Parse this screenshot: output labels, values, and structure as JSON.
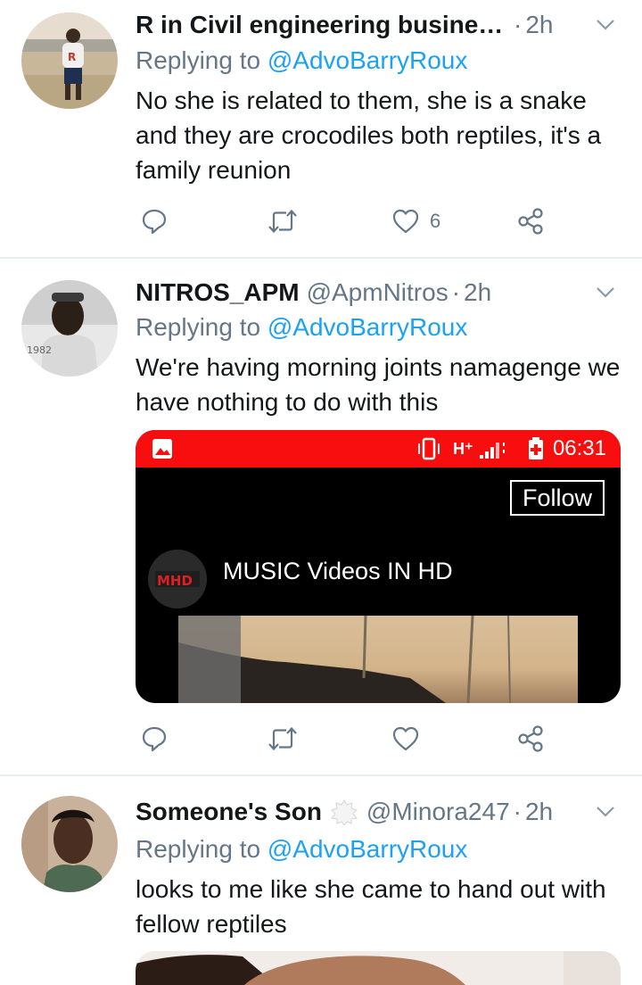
{
  "tweets": [
    {
      "name": "R in Civil engineering business ...",
      "handle": "",
      "time": "2h",
      "replying_label": "Replying to",
      "replying_to": "@AdvoBarryRoux",
      "text": "No she is related to them, she is a snake and they are crocodiles both reptiles, it's a family reunion",
      "likes": "6"
    },
    {
      "name": "NITROS_APM",
      "handle": "@ApmNitros",
      "time": "2h",
      "replying_label": "Replying to",
      "replying_to": "@AdvoBarryRoux",
      "text": "We're having morning joints namagenge we have nothing to do with this",
      "likes": "",
      "media": {
        "status_network": "H⁺",
        "status_time": "06:31",
        "follow_label": "Follow",
        "channel_name": "MUSIC Videos IN HD",
        "logo_text": "MHD"
      }
    },
    {
      "name": "Someone's Son",
      "handle": "@Minora247",
      "time": "2h",
      "replying_label": "Replying to",
      "replying_to": "@AdvoBarryRoux",
      "text": "looks to me like she came to hand out with fellow reptiles"
    }
  ],
  "avatar_texts": {
    "tweet1_shirt": "R",
    "tweet2_shirt": "1982"
  },
  "colors": {
    "accent": "#1da1f2",
    "secondary_text": "#657786",
    "divider": "#e6ecf0",
    "status_bar_red": "#f80e0e"
  },
  "icons": [
    "reply-icon",
    "retweet-icon",
    "like-icon",
    "share-icon",
    "chevron-down-icon",
    "gallery-icon",
    "battery-icon",
    "vibrate-icon",
    "signal-icon",
    "verified-badge-icon"
  ]
}
